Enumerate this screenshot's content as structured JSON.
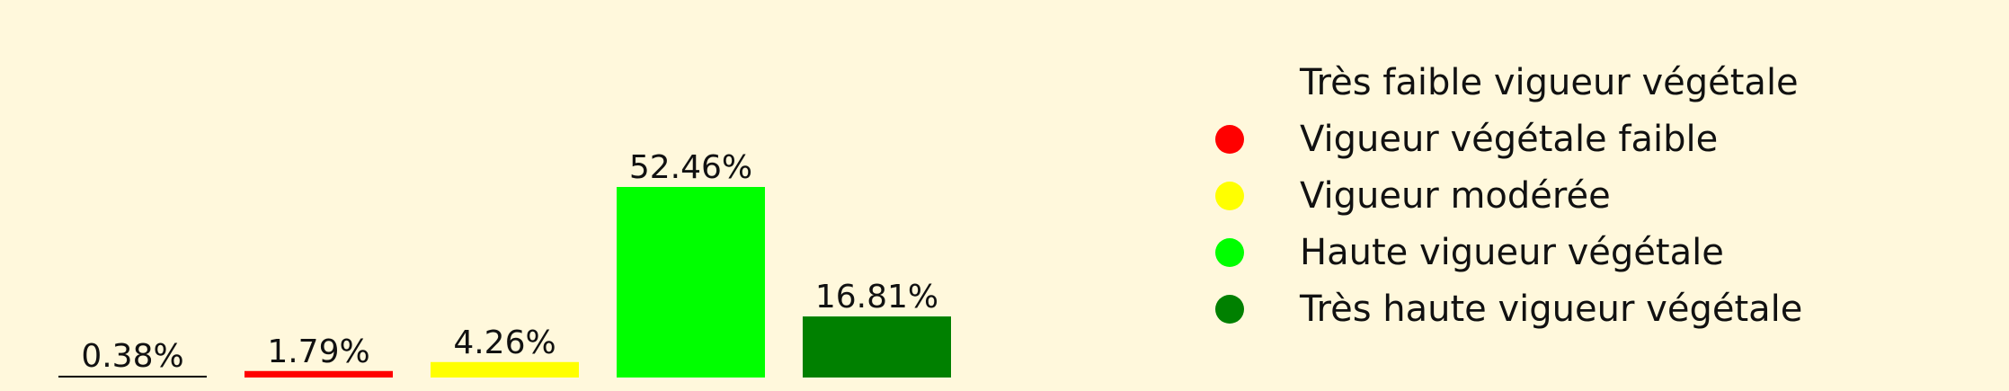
{
  "chart_data": {
    "type": "bar",
    "categories": [
      "Très faible vigueur végétale",
      "Vigueur végétale faible",
      "Vigueur modérée",
      "Haute vigueur végétale",
      "Très haute vigueur végétale"
    ],
    "values": [
      0.38,
      1.79,
      4.26,
      52.46,
      16.81
    ],
    "value_labels": [
      "0.38%",
      "1.79%",
      "4.26%",
      "52.46%",
      "16.81%"
    ],
    "colors": [
      "#000000",
      "#ff0000",
      "#ffff00",
      "#00ff00",
      "#008000"
    ],
    "legend_colors": [
      "#fff8dc",
      "#ff0000",
      "#ffff00",
      "#00ff00",
      "#008000"
    ],
    "ylim": [
      0,
      52.46
    ],
    "grid": false,
    "legend_position": "right",
    "background": "#fff8dc"
  }
}
